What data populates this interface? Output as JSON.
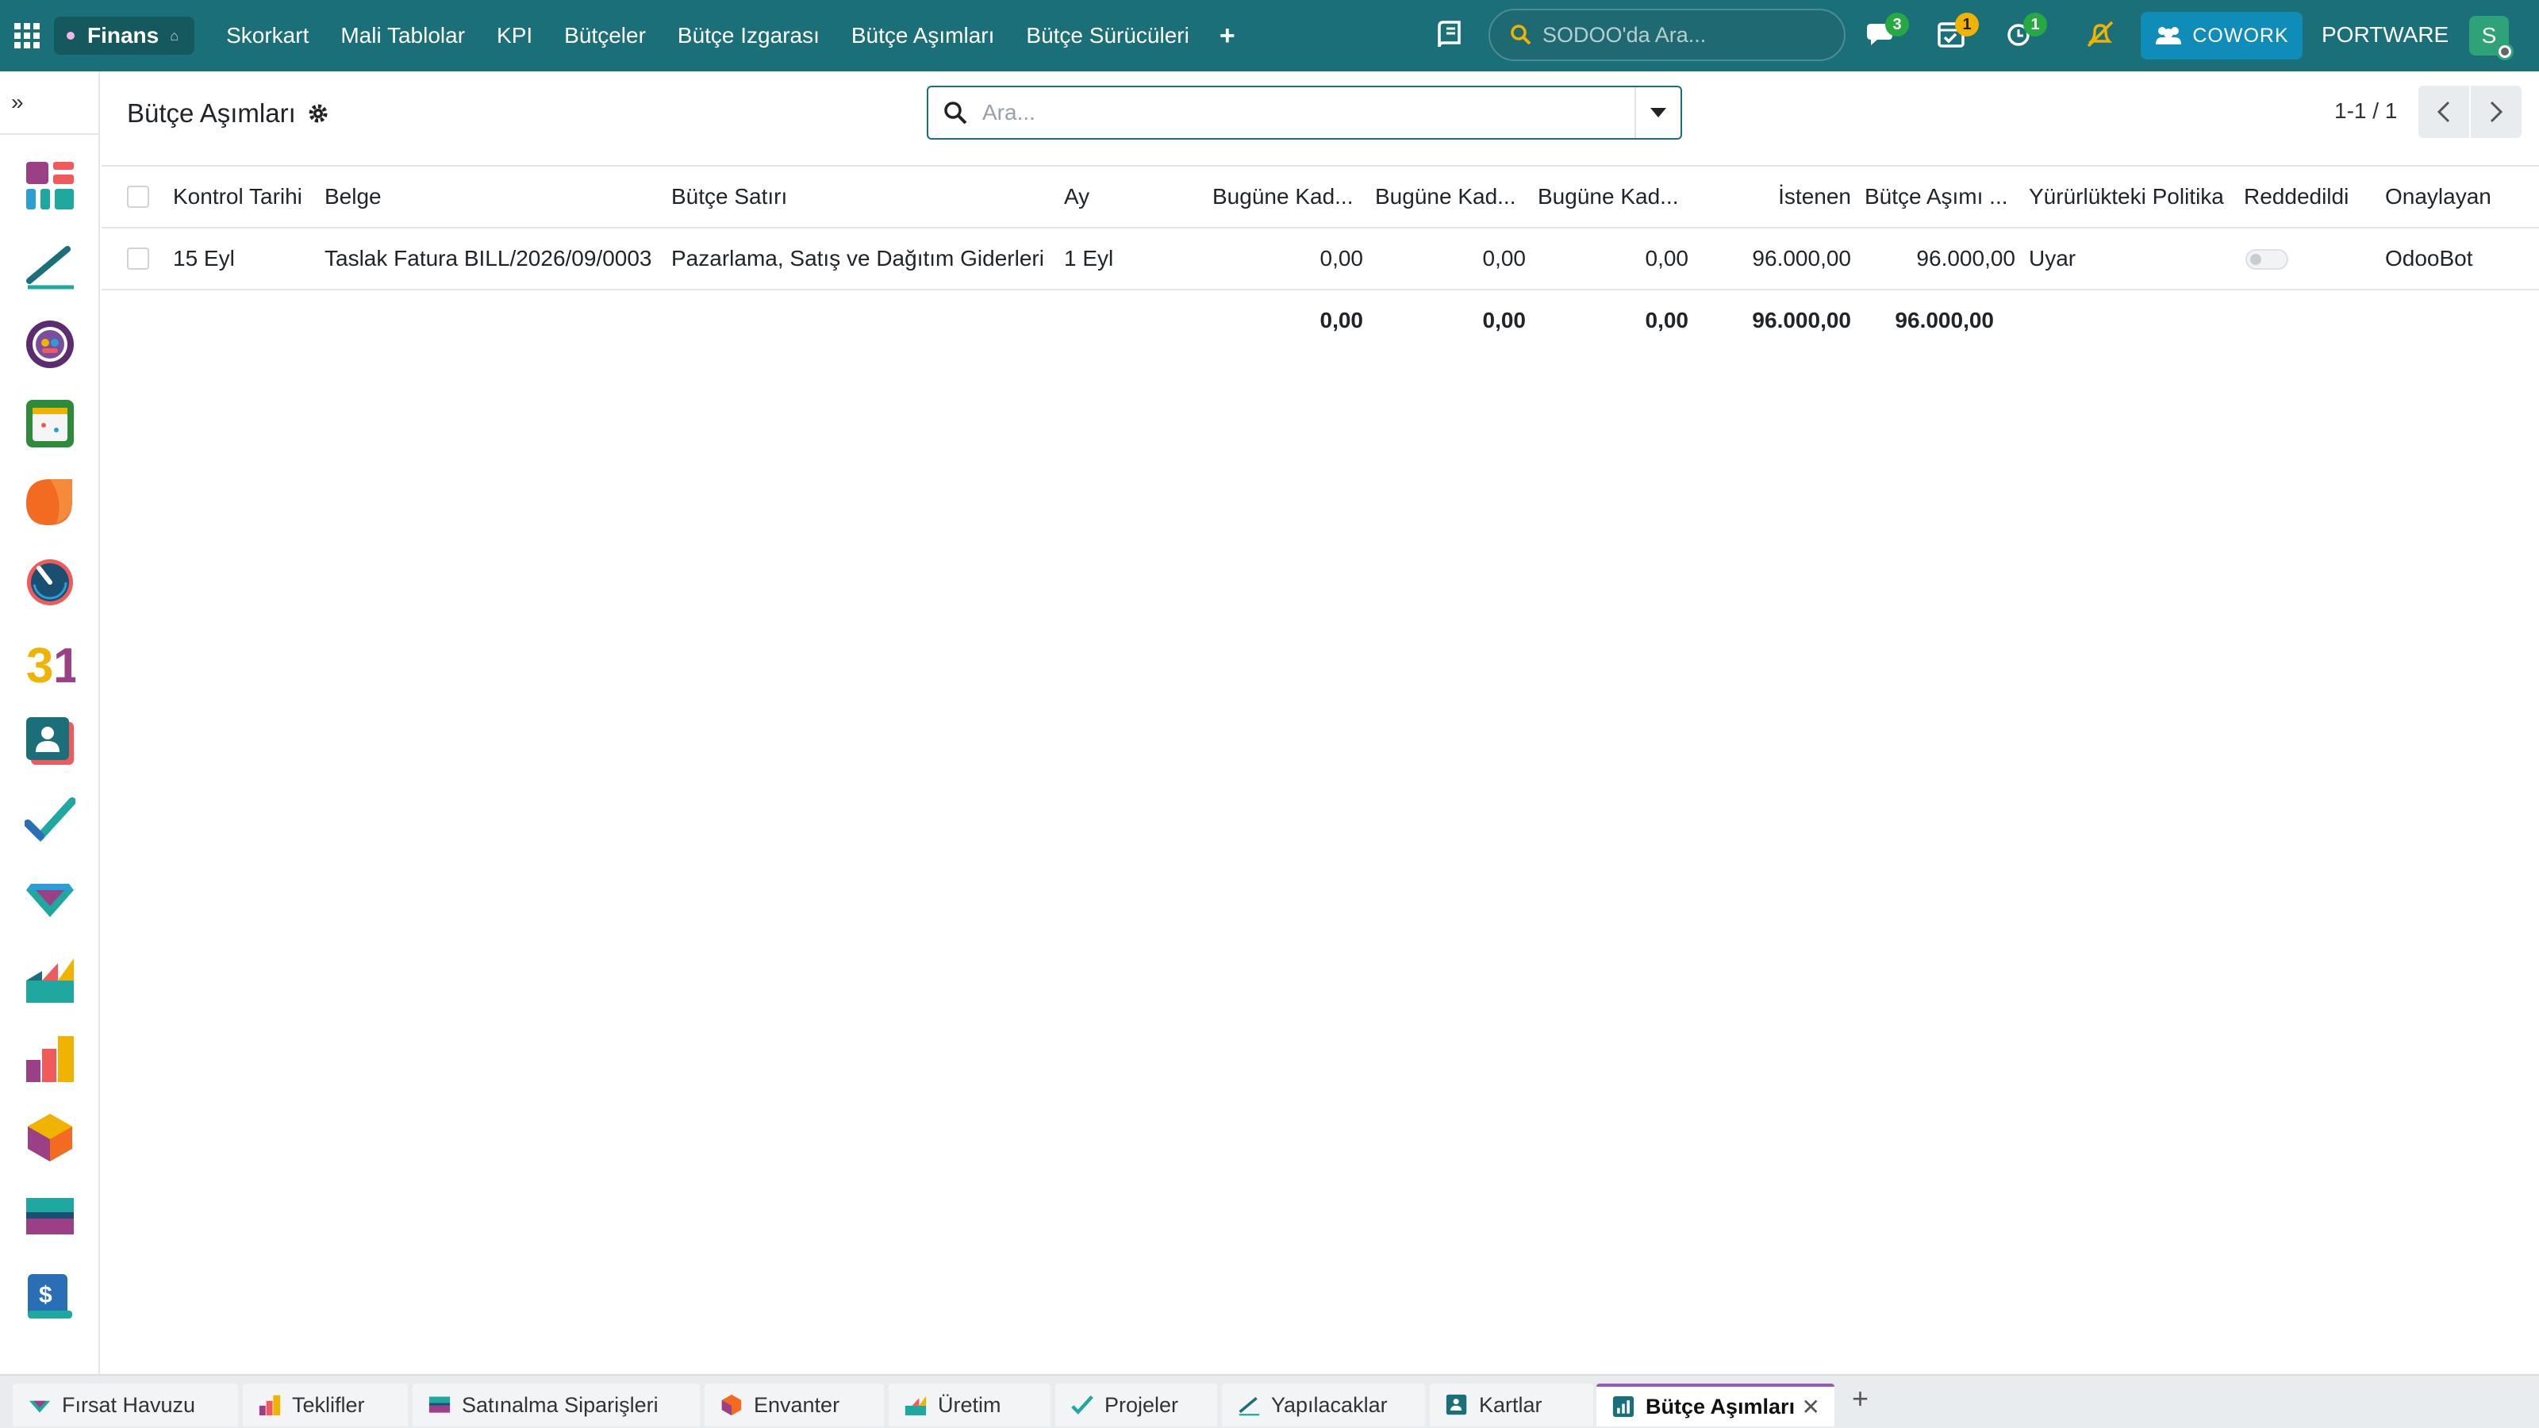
{
  "topbar": {
    "app_name": "Finans",
    "menu": [
      "Skorkart",
      "Mali Tablolar",
      "KPI",
      "Bütçeler",
      "Bütçe Izgarası",
      "Bütçe Aşımları",
      "Bütçe Sürücüleri"
    ],
    "add_menu": "+",
    "search_placeholder": "SODOO'da Ara...",
    "messages_count": "3",
    "activities_count": "1",
    "timer_count": "1",
    "cowork_label": "COWORK",
    "company": "PORTWARE",
    "user_initial": "S"
  },
  "sidebar": {
    "collapse_icon": "»",
    "apps": [
      "dashboard-icon",
      "todo-icon",
      "crm-icon",
      "calendar-icon",
      "discuss-icon",
      "timesheet-icon",
      "agenda-31-icon",
      "contacts-icon",
      "project-icon",
      "crm-handshake-icon",
      "manufacturing-icon",
      "sales-icon",
      "inventory-icon",
      "purchase-icon",
      "invoice-icon"
    ]
  },
  "control_panel": {
    "title": "Bütçe Aşımları",
    "search_placeholder": "Ara...",
    "pager": "1-1 / 1"
  },
  "table": {
    "headers": [
      "Kontrol Tarihi",
      "Belge",
      "Bütçe Satırı",
      "Ay",
      "Bugüne Kad...",
      "Bugüne Kad...",
      "Bugüne Kad...",
      "İstenen",
      "Bütçe Aşımı ...",
      "Yürürlükteki Politika",
      "Reddedildi",
      "Onaylayan"
    ],
    "rows": [
      {
        "date": "15 Eyl",
        "document": "Taslak Fatura BILL/2026/09/0003",
        "budget_line": "Pazarlama, Satış ve Dağıtım Giderleri",
        "month": "1 Eyl",
        "todate1": "0,00",
        "todate2": "0,00",
        "todate3": "0,00",
        "requested": "96.000,00",
        "overrun": "96.000,00",
        "policy": "Uyar",
        "rejected": false,
        "approved_by": "OdooBot"
      }
    ],
    "totals": {
      "todate1": "0,00",
      "todate2": "0,00",
      "todate3": "0,00",
      "requested": "96.000,00",
      "overrun": "96.000,00"
    }
  },
  "tabs": [
    {
      "label": "Fırsat Havuzu",
      "icon": "crm-handshake-icon"
    },
    {
      "label": "Teklifler",
      "icon": "sales-icon"
    },
    {
      "label": "Satınalma Siparişleri",
      "icon": "purchase-icon"
    },
    {
      "label": "Envanter",
      "icon": "inventory-icon"
    },
    {
      "label": "Üretim",
      "icon": "manufacturing-icon"
    },
    {
      "label": "Projeler",
      "icon": "project-icon"
    },
    {
      "label": "Yapılacaklar",
      "icon": "todo-icon"
    },
    {
      "label": "Kartlar",
      "icon": "contacts-icon"
    },
    {
      "label": "Bütçe Aşımları",
      "icon": "budget-report-icon",
      "active": true
    }
  ],
  "tab_close": "✕",
  "tab_add": "+"
}
